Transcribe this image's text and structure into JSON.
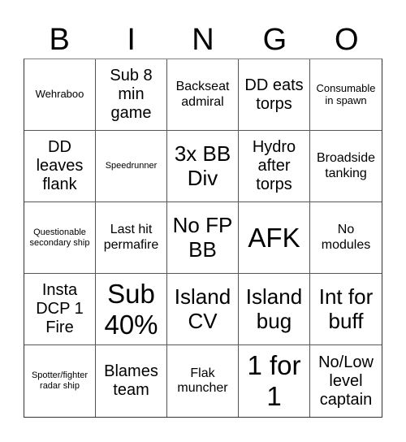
{
  "header": {
    "letters": [
      "B",
      "I",
      "N",
      "G",
      "O"
    ]
  },
  "cells": [
    {
      "text": "Wehraboo",
      "size": "s-sm"
    },
    {
      "text": "Sub 8 min game",
      "size": "s-lg"
    },
    {
      "text": "Backseat admiral",
      "size": "s-md"
    },
    {
      "text": "DD eats torps",
      "size": "s-lg"
    },
    {
      "text": "Consumable in spawn",
      "size": "s-sm"
    },
    {
      "text": "DD leaves flank",
      "size": "s-lg"
    },
    {
      "text": "Speedrunner",
      "size": "s-xs"
    },
    {
      "text": "3x BB Div",
      "size": "s-xl"
    },
    {
      "text": "Hydro after torps",
      "size": "s-lg"
    },
    {
      "text": "Broadside tanking",
      "size": "s-md"
    },
    {
      "text": "Questionable secondary ship",
      "size": "s-xs"
    },
    {
      "text": "Last hit permafire",
      "size": "s-md"
    },
    {
      "text": "No FP BB",
      "size": "s-xl"
    },
    {
      "text": "AFK",
      "size": "s-xxl"
    },
    {
      "text": "No modules",
      "size": "s-md"
    },
    {
      "text": "Insta DCP 1 Fire",
      "size": "s-lg"
    },
    {
      "text": "Sub 40%",
      "size": "s-xxl"
    },
    {
      "text": "Island CV",
      "size": "s-xl"
    },
    {
      "text": "Island bug",
      "size": "s-xl"
    },
    {
      "text": "Int for buff",
      "size": "s-xl"
    },
    {
      "text": "Spotter/fighter radar ship",
      "size": "s-xs"
    },
    {
      "text": "Blames team",
      "size": "s-lg"
    },
    {
      "text": "Flak muncher",
      "size": "s-md"
    },
    {
      "text": "1 for 1",
      "size": "s-xxl"
    },
    {
      "text": "No/Low level captain",
      "size": "s-lg"
    }
  ]
}
